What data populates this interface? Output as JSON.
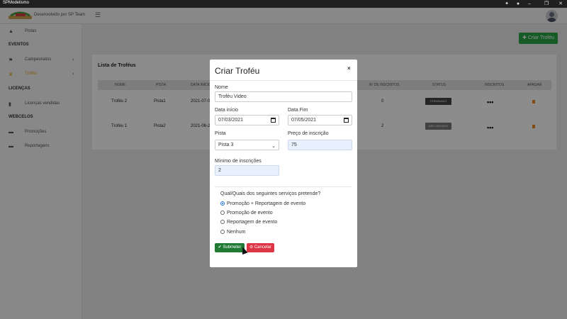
{
  "window": {
    "title": "SPModelismo",
    "icons": [
      "puzzle-icon",
      "bell-icon",
      "minimize-icon",
      "maximize-icon",
      "close-icon"
    ]
  },
  "topbar": {
    "dev_text": "Desenvolvido por SP Team",
    "menu_icon": "hamburger-icon"
  },
  "sidebar": {
    "pistas": "Pistas",
    "eventos_head": "EVENTOS",
    "campeonatos": "Campeonatos",
    "trofeu": "Troféu",
    "licencas_head": "LICENÇAS",
    "licencas_vendidas": "Licenças vendidas",
    "webcelos_head": "WEBCELOS",
    "promocoes": "Promoções",
    "reportagens": "Reportagens"
  },
  "main": {
    "criar_btn": "Criar Troféu",
    "card_title": "Lista de Troféus",
    "headers": [
      "NOME",
      "PISTA",
      "DATA INÍCIO",
      "Nº DE INSCRITOS",
      "STATUS",
      "INSCRITOS",
      "APAGAR"
    ],
    "rows": [
      {
        "nome": "Troféu 2",
        "pista": "Pista1",
        "data": "2021-07-0",
        "inscritos": "0",
        "status": "TERMINADO"
      },
      {
        "nome": "Troféu 1",
        "pista": "Pista2",
        "data": "2021-06-2",
        "inscritos": "2",
        "status": "NÃO INICIADO"
      }
    ],
    "colors": {
      "accent_green": "#28a745",
      "active_orange": "#e8a020"
    }
  },
  "modal": {
    "title": "Criar Troféu",
    "close": "×",
    "nome_label": "Nome",
    "nome_value": "Troféu Video",
    "data_inicio_label": "Data início",
    "data_inicio_value": "07/03/2021",
    "data_fim_label": "Data Fim",
    "data_fim_value": "07/05/2021",
    "pista_label": "Pista",
    "pista_value": "Pista 3",
    "preco_label": "Preço de inscrição",
    "preco_value": "75",
    "minimo_label": "Mínimo de inscrições",
    "minimo_value": "2",
    "question": "Qual/Quais dos seguintes serviços pretende?",
    "options": [
      "Promoção + Reportagem de evento",
      "Promoção de evento",
      "Reportagem de evento",
      "Nenhum"
    ],
    "selected_option": 0,
    "submit": "Submeter",
    "cancel": "Cancelar"
  }
}
